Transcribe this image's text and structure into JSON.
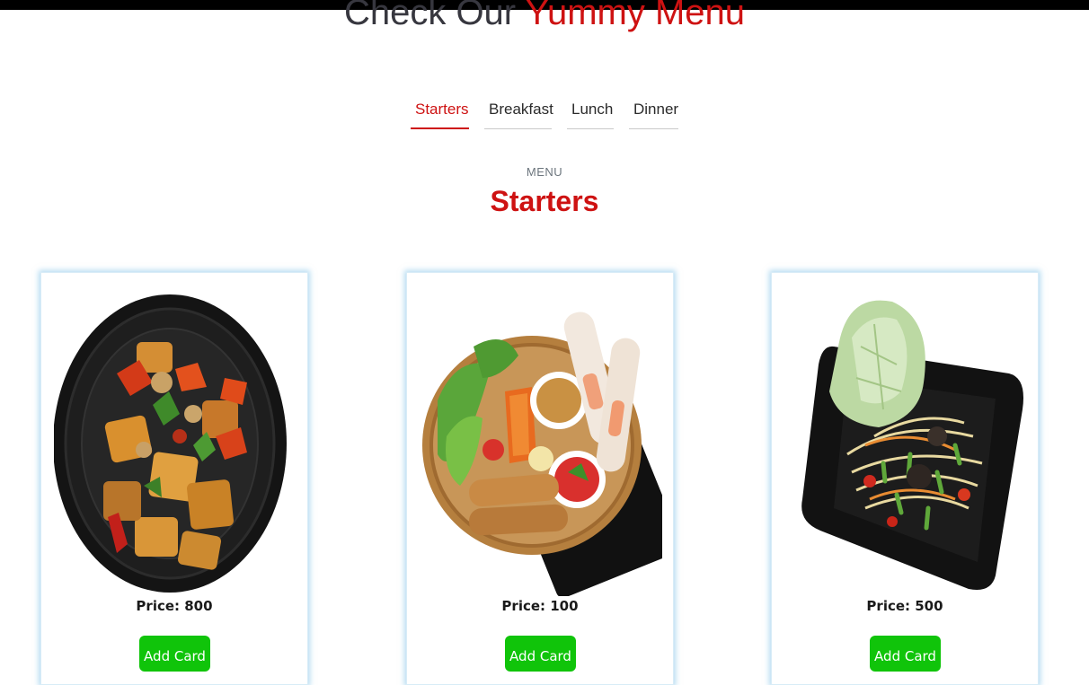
{
  "heading": {
    "prefix": "Check Our",
    "accent": "Yummy Menu"
  },
  "tabs": [
    {
      "label": "Starters",
      "active": true
    },
    {
      "label": "Breakfast",
      "active": false
    },
    {
      "label": "Lunch",
      "active": false
    },
    {
      "label": "Dinner",
      "active": false
    }
  ],
  "section": {
    "sub_label": "MENU",
    "title": "Starters"
  },
  "cards": [
    {
      "image_icon": "tofu-dish-image",
      "price": "Price: 800",
      "button": "Add Card"
    },
    {
      "image_icon": "spring-roll-platter-image",
      "price": "Price: 100",
      "button": "Add Card"
    },
    {
      "image_icon": "papaya-salad-image",
      "price": "Price: 500",
      "button": "Add Card"
    }
  ],
  "colors": {
    "accent": "#ce1212",
    "button": "#10c40a",
    "text": "#37373f"
  }
}
